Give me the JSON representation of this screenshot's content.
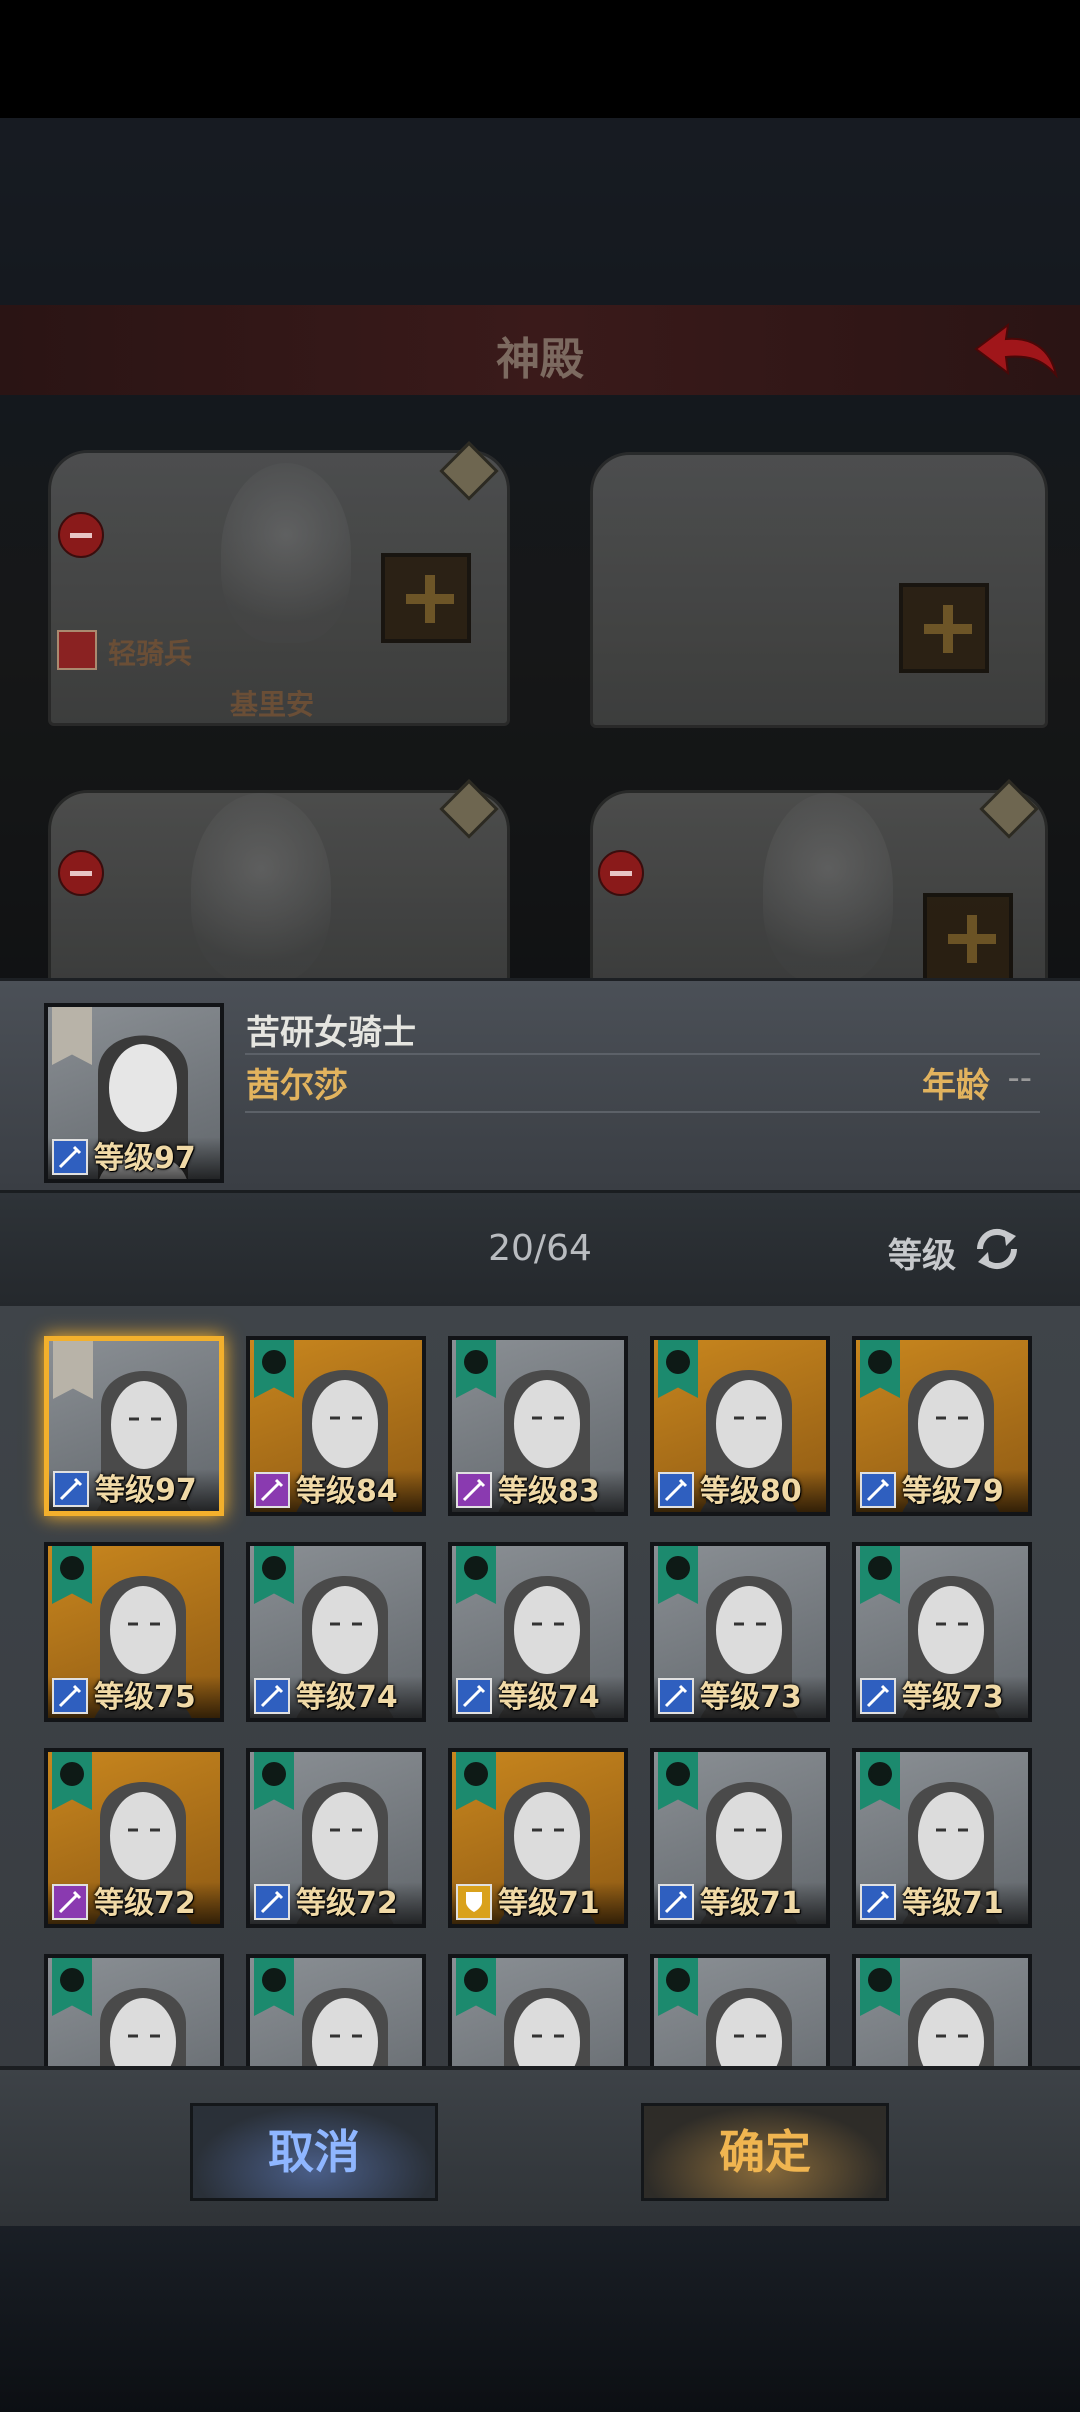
{
  "header": {
    "title": "神殿"
  },
  "slots": [
    {
      "name": "基里安",
      "tag": "轻骑兵"
    },
    {
      "name": "",
      "tag": ""
    },
    {
      "name": "",
      "tag": ""
    },
    {
      "name": "",
      "tag": ""
    }
  ],
  "selected": {
    "title": "苦研女骑士",
    "name": "茜尔莎",
    "age_label": "年龄",
    "age_value": "--",
    "level_label": "等级97"
  },
  "list": {
    "count": "20/64",
    "sort_label": "等级"
  },
  "heroes": [
    {
      "level": "等级97",
      "bg": "grey",
      "cls": "blue",
      "flag": "white",
      "selected": true
    },
    {
      "level": "等级84",
      "bg": "gold",
      "cls": "purple",
      "flag": "teal"
    },
    {
      "level": "等级83",
      "bg": "grey",
      "cls": "purple",
      "flag": "teal"
    },
    {
      "level": "等级80",
      "bg": "gold",
      "cls": "blue",
      "flag": "teal"
    },
    {
      "level": "等级79",
      "bg": "gold",
      "cls": "blue",
      "flag": "teal"
    },
    {
      "level": "等级75",
      "bg": "gold",
      "cls": "blue",
      "flag": "teal"
    },
    {
      "level": "等级74",
      "bg": "grey",
      "cls": "blue",
      "flag": "teal"
    },
    {
      "level": "等级74",
      "bg": "grey",
      "cls": "blue",
      "flag": "teal"
    },
    {
      "level": "等级73",
      "bg": "grey",
      "cls": "blue",
      "flag": "teal"
    },
    {
      "level": "等级73",
      "bg": "grey",
      "cls": "blue",
      "flag": "teal"
    },
    {
      "level": "等级72",
      "bg": "gold",
      "cls": "purple",
      "flag": "teal"
    },
    {
      "level": "等级72",
      "bg": "grey",
      "cls": "blue",
      "flag": "teal"
    },
    {
      "level": "等级71",
      "bg": "gold",
      "cls": "gold",
      "flag": "teal"
    },
    {
      "level": "等级71",
      "bg": "grey",
      "cls": "blue",
      "flag": "teal"
    },
    {
      "level": "等级71",
      "bg": "grey",
      "cls": "blue",
      "flag": "teal"
    },
    {
      "level": "",
      "bg": "grey",
      "cls": "",
      "flag": "teal"
    },
    {
      "level": "",
      "bg": "grey",
      "cls": "",
      "flag": "teal"
    },
    {
      "level": "",
      "bg": "grey",
      "cls": "",
      "flag": "teal"
    },
    {
      "level": "",
      "bg": "grey",
      "cls": "",
      "flag": "teal"
    },
    {
      "level": "",
      "bg": "grey",
      "cls": "",
      "flag": "teal"
    }
  ],
  "buttons": {
    "cancel": "取消",
    "confirm": "确定"
  }
}
